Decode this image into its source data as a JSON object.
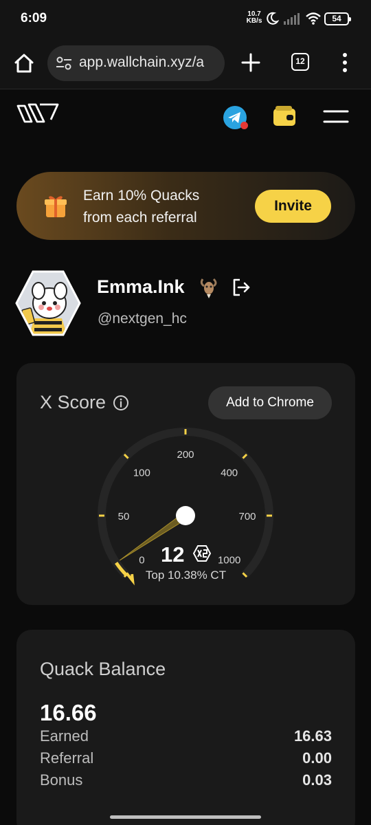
{
  "status_bar": {
    "time": "6:09",
    "net_speed_value": "10.7",
    "net_speed_unit": "KB/s",
    "battery": "54"
  },
  "browser": {
    "url": "app.wallchain.xyz/a",
    "tab_count": "12"
  },
  "header": {
    "icons": [
      "wallchain-logo",
      "telegram-icon",
      "wallet-icon",
      "hamburger-menu-icon"
    ]
  },
  "invite_banner": {
    "line1": "Earn 10% Quacks",
    "line2": "from each referral",
    "button_label": "Invite",
    "accent_color": "#f6d247"
  },
  "profile": {
    "name": "Emma.Ink",
    "handle": "@nextgen_hc"
  },
  "x_score": {
    "title": "X Score",
    "add_button_label": "Add to Chrome",
    "gauge_ticks": [
      "0",
      "50",
      "100",
      "200",
      "400",
      "700",
      "1000"
    ],
    "score": "12",
    "score_numeric": 12,
    "rank_text": "Top 10.38% CT"
  },
  "quack_balance": {
    "title": "Quack Balance",
    "total": "16.66",
    "rows": [
      {
        "label": "Earned",
        "amount": "16.63"
      },
      {
        "label": "Referral",
        "amount": "0.00"
      },
      {
        "label": "Bonus",
        "amount": "0.03"
      }
    ]
  }
}
